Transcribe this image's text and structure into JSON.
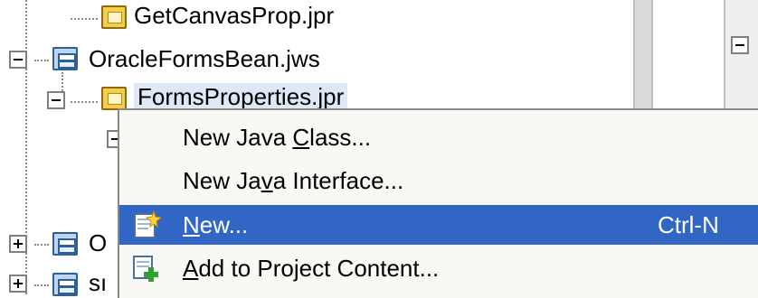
{
  "tree": {
    "items": [
      {
        "label": "GetCanvasProp.jpr",
        "icon": "project-icon"
      },
      {
        "label": "OracleFormsBean.jws",
        "icon": "workspace-icon"
      },
      {
        "label": "FormsProperties.jpr",
        "icon": "project-icon"
      },
      {
        "label": "O",
        "icon": "workspace-icon"
      },
      {
        "label": "sı",
        "icon": "workspace-icon"
      }
    ]
  },
  "context_menu": {
    "items": [
      {
        "pre": "New Java ",
        "mnemonic": "C",
        "post": "lass...",
        "shortcut": "",
        "icon": ""
      },
      {
        "pre": "New Ja",
        "mnemonic": "v",
        "post": "a Interface...",
        "shortcut": "",
        "icon": ""
      },
      {
        "pre": "",
        "mnemonic": "N",
        "post": "ew...",
        "shortcut": "Ctrl-N",
        "icon": "new-gallery-icon",
        "selected": true
      },
      {
        "pre": "",
        "mnemonic": "A",
        "post": "dd to Project Content...",
        "shortcut": "",
        "icon": "add-to-project-icon"
      }
    ]
  },
  "colors": {
    "selection": "#3166c4",
    "menu_background": "#f9f8f4"
  }
}
